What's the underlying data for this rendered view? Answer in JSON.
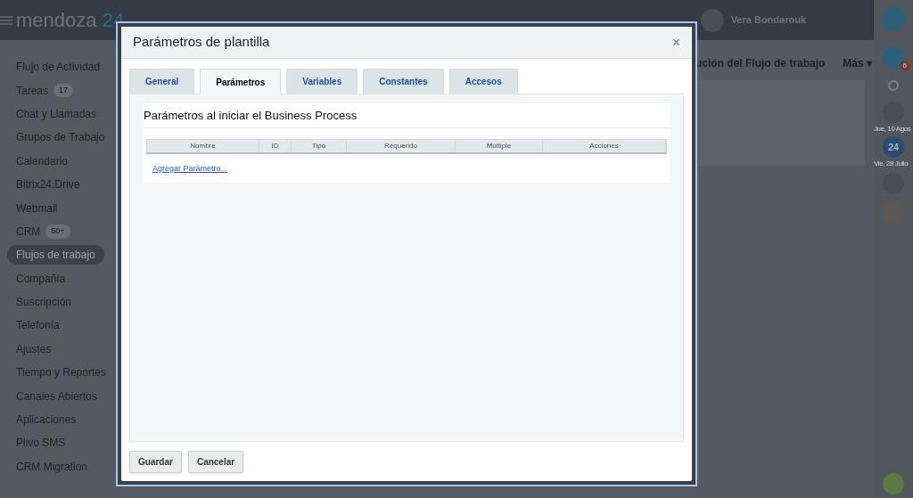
{
  "header": {
    "logo_name": "mendoza",
    "logo_number": "24",
    "user": "Vera Bondarouk"
  },
  "sidebar": {
    "items": [
      {
        "label": "Flujo de Actividad",
        "selected": false
      },
      {
        "label": "Tareas",
        "count": "17",
        "selected": false
      },
      {
        "label": "Chat y Llamadas",
        "selected": false
      },
      {
        "label": "Grupos de Trabajo",
        "selected": false
      },
      {
        "label": "Calendario",
        "selected": false
      },
      {
        "label": "Bitrix24.Drive",
        "selected": false
      },
      {
        "label": "Webmail",
        "selected": false
      },
      {
        "label": "CRM",
        "count": "50+",
        "selected": false
      },
      {
        "label": "Flujos de trabajo",
        "selected": true
      },
      {
        "label": "Compañía",
        "selected": false
      },
      {
        "label": "Suscripción",
        "selected": false
      },
      {
        "label": "Telefonía",
        "selected": false
      },
      {
        "label": "Ajustes",
        "selected": false
      },
      {
        "label": "Tiempo y Reportes",
        "selected": false
      },
      {
        "label": "Canales Abiertos",
        "selected": false
      },
      {
        "label": "Aplicaciones",
        "selected": false
      },
      {
        "label": "Plivo SMS",
        "selected": false
      },
      {
        "label": "CRM Migration",
        "selected": false
      }
    ]
  },
  "background_tabs": [
    "ución del Flujo de trabajo",
    "Más"
  ],
  "more_caret": "▾",
  "right_panel": {
    "notification_count": "6",
    "dates": [
      "Jue, 10 Agos",
      "Vie, 28 Julio"
    ],
    "logo_badge": "24"
  },
  "dialog": {
    "title": "Parámetros de plantilla",
    "close": "×",
    "tabs": [
      {
        "label": "General",
        "selected": false
      },
      {
        "label": "Parámetros",
        "selected": true
      },
      {
        "label": "Variables",
        "selected": false
      },
      {
        "label": "Constantes",
        "selected": false
      },
      {
        "label": "Accesos",
        "selected": false
      }
    ],
    "section_title": "Parámetros al iniciar el Business Process",
    "table": {
      "columns": [
        "Nombre",
        "ID",
        "Tipo",
        "Requerido",
        "Múltiple",
        "Acciones"
      ]
    },
    "add_link": "Agregar Parámetro...",
    "buttons": [
      "Guardar",
      "Cancelar"
    ]
  }
}
